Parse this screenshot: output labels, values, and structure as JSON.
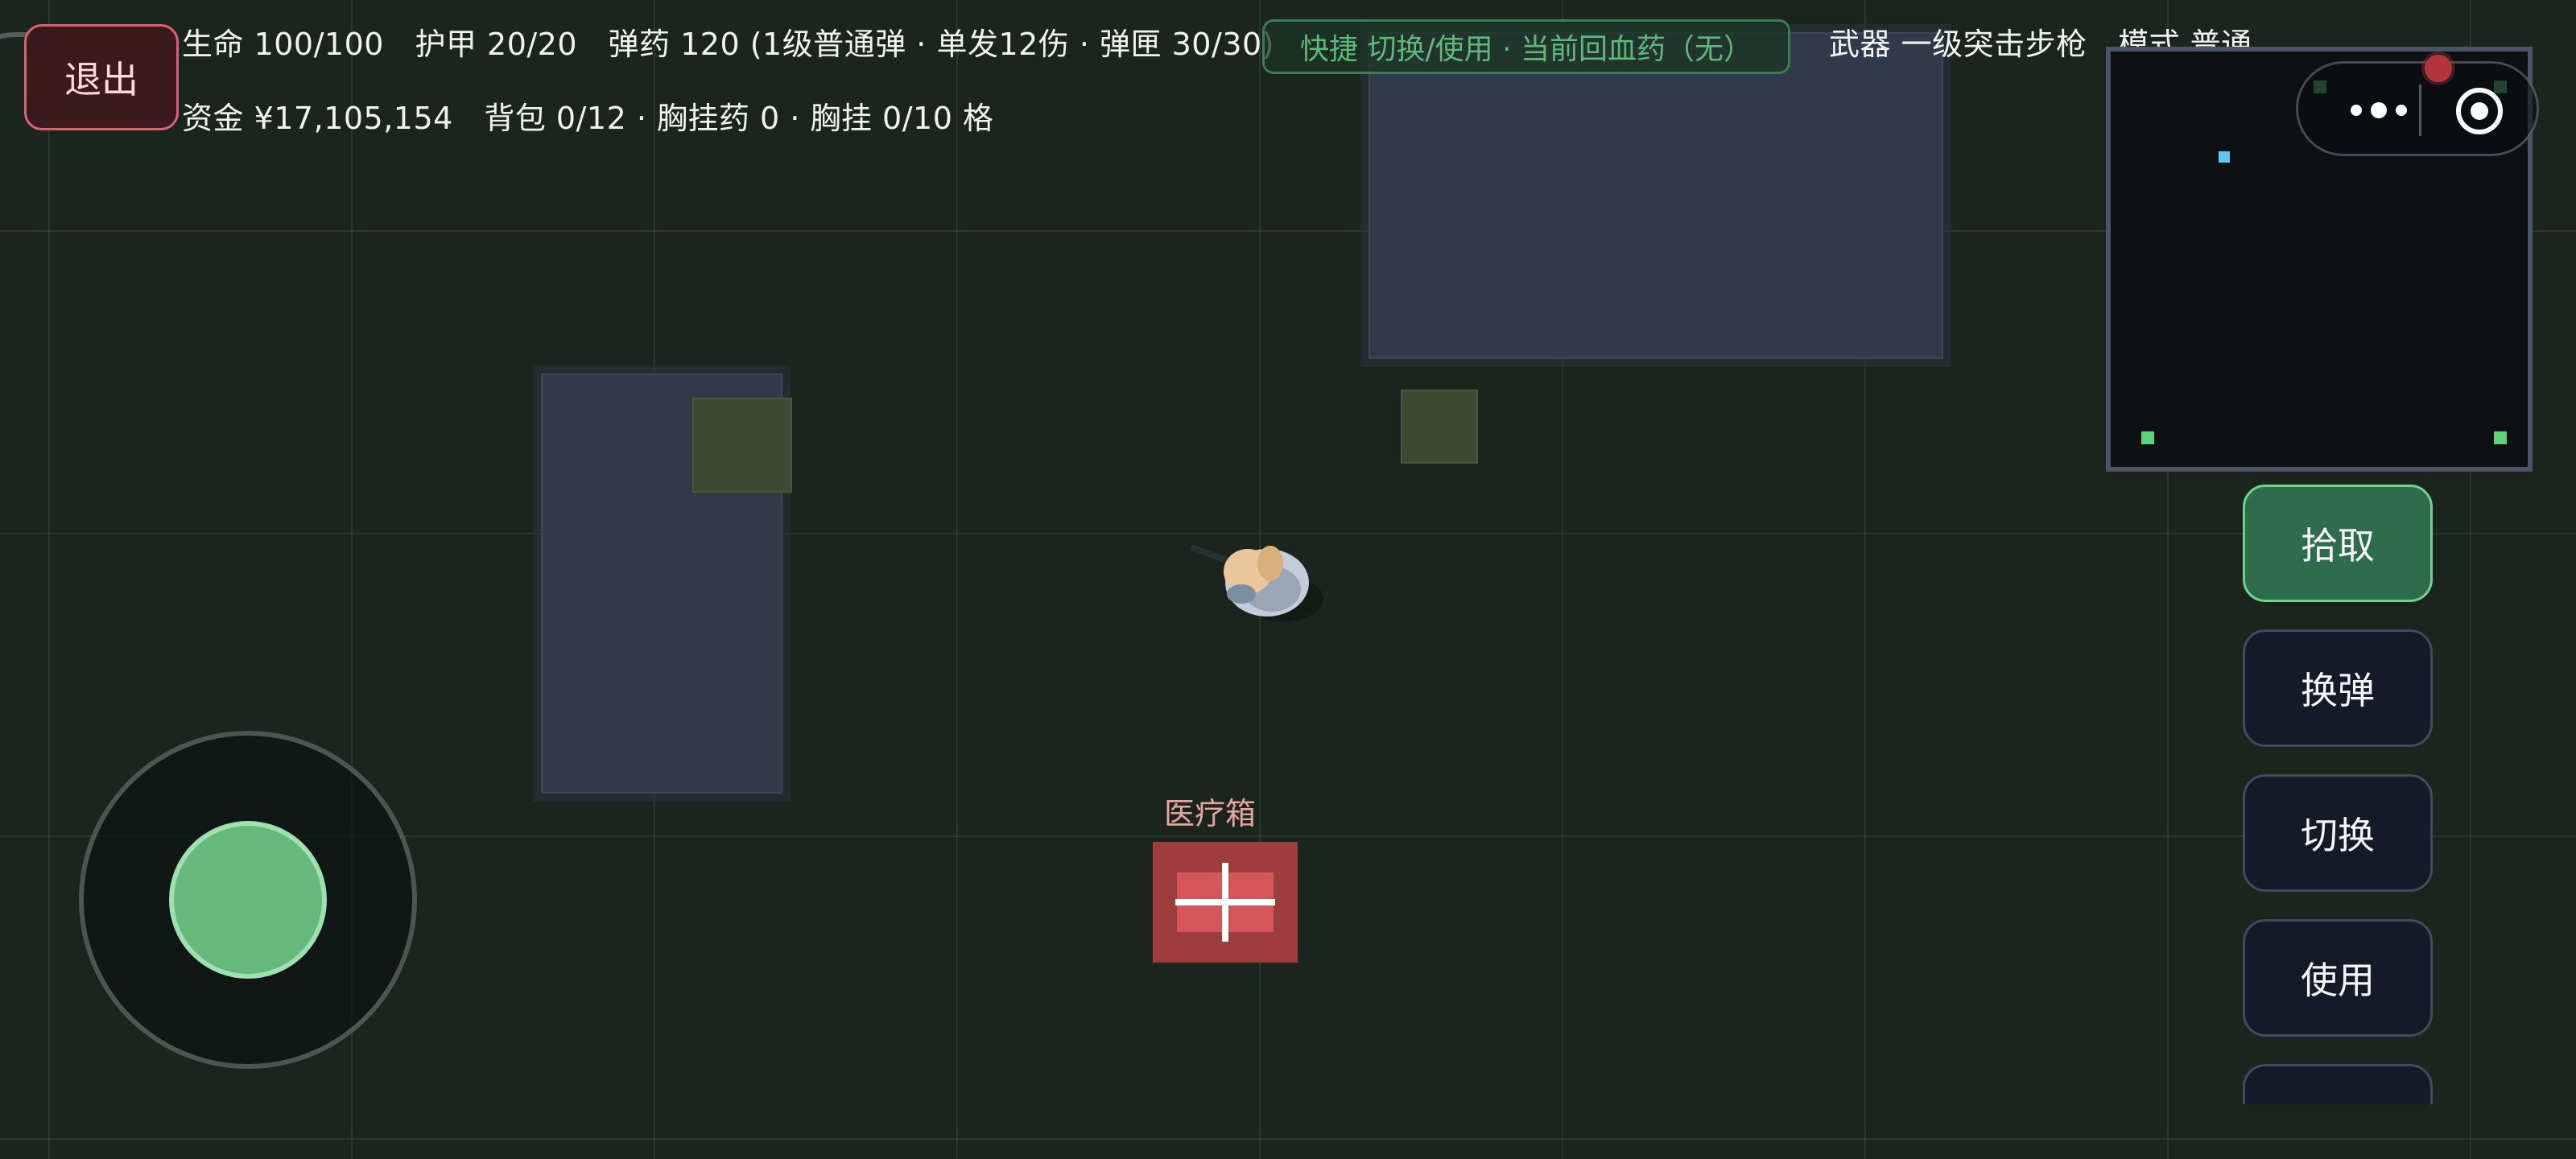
{
  "hud": {
    "stats_line1": "生命 100/100　护甲 20/20　弹药 120 (1级普通弹 · 单发12伤 · 弹匣 30/30)",
    "stats_line2": "资金 ¥17,105,154　背包 0/12 · 胸挂药 0 · 胸挂 0/10 格",
    "quick_bar": "快捷 切换/使用 · 当前回血药（无）",
    "weapon_mode": "武器 一级突击步枪　模式 普通",
    "exit_label": "退出"
  },
  "actions": {
    "pickup": "拾取",
    "reload": "换弹",
    "switch": "切换",
    "use": "使用"
  },
  "map": {
    "medkit_label": "医疗箱"
  },
  "colors": {
    "primary_action": "#2e6c4d",
    "exit_border": "#d9646f",
    "quick_text": "#5fb97a",
    "joystick_knob": "#66b87d",
    "medkit": "#9e3d3f"
  },
  "icons": {
    "more": "more-dots-icon",
    "target": "target-icon",
    "cross": "medical-cross-icon"
  }
}
